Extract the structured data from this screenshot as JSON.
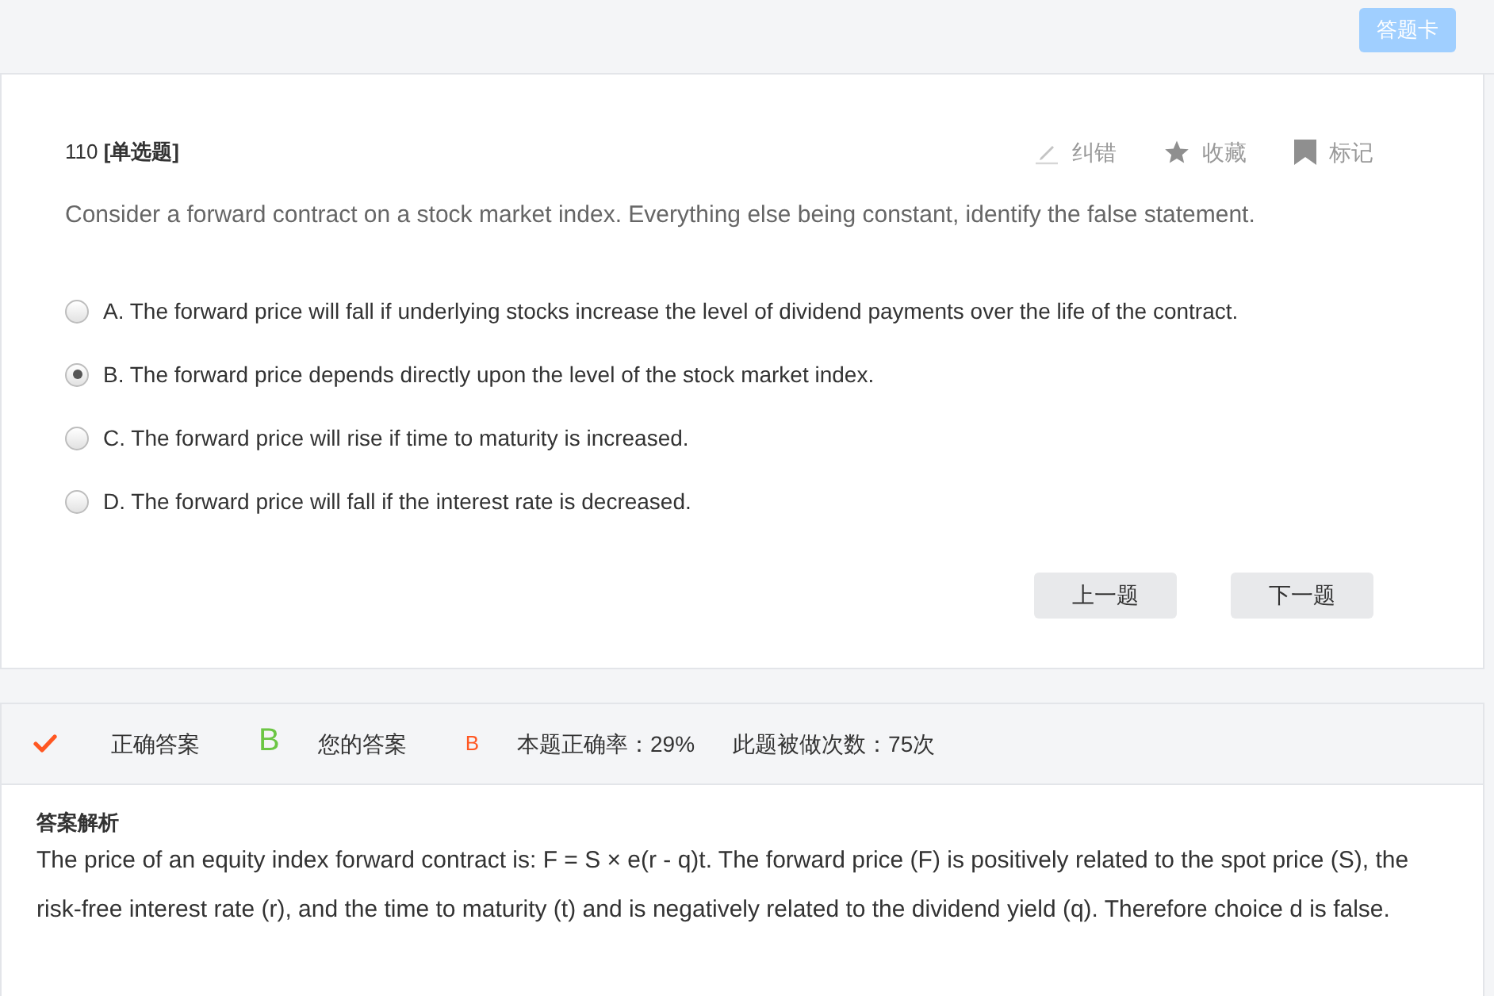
{
  "top_bar": {
    "answer_card_button": "答题卡"
  },
  "question": {
    "title": "110 **[单选题]**",
    "actions": [
      {
        "kind": "report",
        "label": "纠错"
      },
      {
        "kind": "favorite",
        "label": "收藏"
      },
      {
        "kind": "flag",
        "label": "标记"
      }
    ],
    "stem": "Consider a forward contract on a stock market index. Everything else being constant, identify the false statement.",
    "options": [
      {
        "text": "A. The forward price will fall if underlying stocks increase the level of dividend payments over the life of the contract.",
        "selected": false
      },
      {
        "text": "B. The forward price depends directly upon the level of the stock market index.",
        "selected": true
      },
      {
        "text": "C. The forward price will rise if time to maturity is increased.",
        "selected": false
      },
      {
        "text": "D. The forward price will fall if the interest rate is decreased.",
        "selected": false
      }
    ],
    "buttons": [
      "上一题",
      "下一题"
    ]
  },
  "result": {
    "answered_correctly": true,
    "correct_label": "正确答案",
    "correct_answer": "B",
    "your_label": "您的答案",
    "your_answer": "B",
    "accuracy": "本题正确率：29%",
    "attempts": "此题被做次数：75次"
  },
  "analysis": {
    "title": "答案解析",
    "text": "The price of an equity index forward contract is: F = S × e(r - q)t. The forward price (F) is positively related to the spot price (S), the risk-free interest rate (r), and the time to maturity (t) and is negatively related to the dividend yield (q). Therefore choice d is false."
  }
}
